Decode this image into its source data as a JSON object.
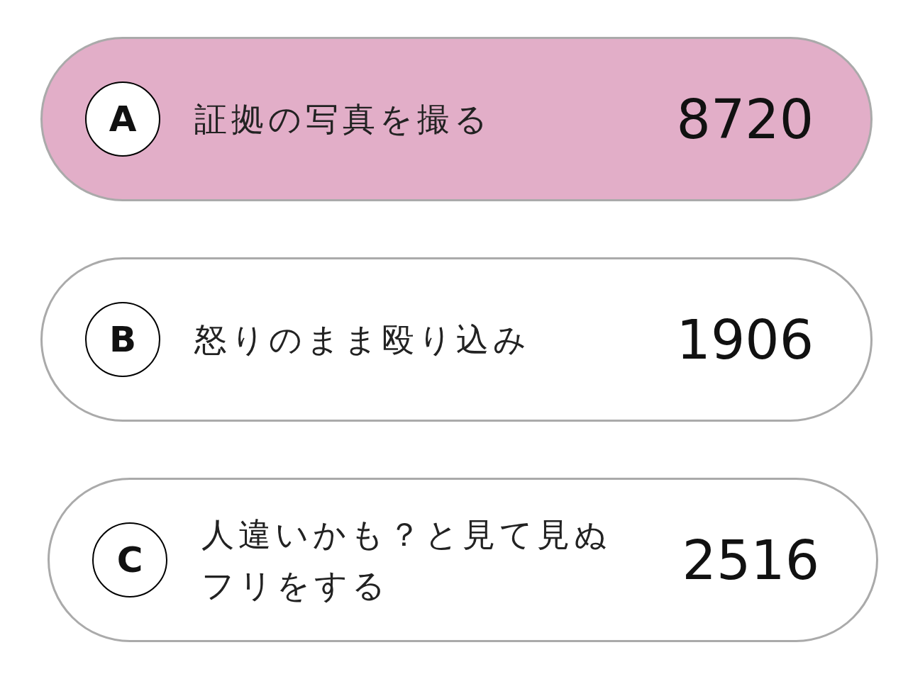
{
  "options": [
    {
      "letter": "A",
      "label": "証拠の写真を撮る",
      "votes": "8720",
      "selected": true
    },
    {
      "letter": "B",
      "label": "怒りのまま殴り込み",
      "votes": "1906",
      "selected": false
    },
    {
      "letter": "C",
      "label": "人違いかも？と見て見ぬフリをする",
      "votes": "2516",
      "selected": false
    }
  ]
}
